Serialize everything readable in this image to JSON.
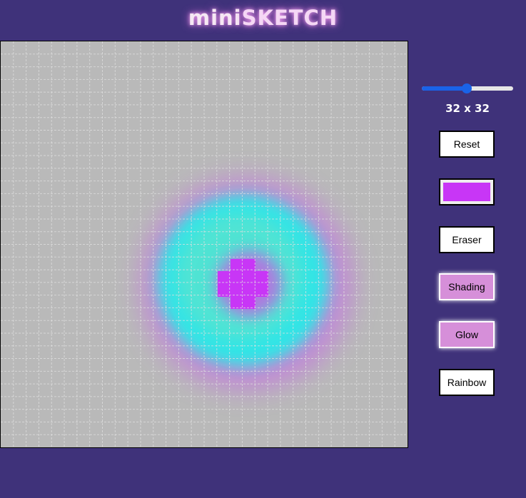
{
  "app": {
    "title_part1": "mini",
    "title_part2": "SKETCH"
  },
  "grid": {
    "size": 32,
    "background_color": "#b9b9b9",
    "line_color": "#e0e0e0"
  },
  "controls": {
    "slider_value": 32,
    "slider_min": 1,
    "slider_max": 64,
    "size_label": "32 x 32",
    "reset_label": "Reset",
    "color_value": "#c836f6",
    "eraser_label": "Eraser",
    "shading_label": "Shading",
    "glow_label": "Glow",
    "rainbow_label": "Rainbow"
  },
  "colors": {
    "background": "#3f327a",
    "purple": "#c836f6",
    "cyan": "#16f4ee",
    "active_button": "#d68fd9",
    "slider_blue": "#1a63e8"
  }
}
